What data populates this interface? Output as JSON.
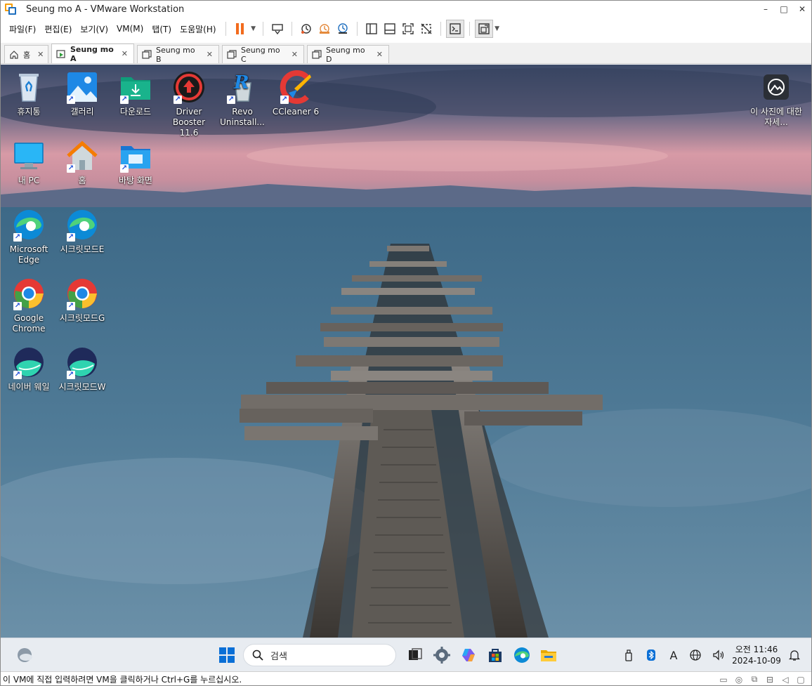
{
  "window": {
    "title": "Seung mo A - VMware Workstation",
    "minimize": "–",
    "maximize": "□",
    "close": "✕"
  },
  "menu": [
    "파일(F)",
    "편집(E)",
    "보기(V)",
    "VM(M)",
    "탭(T)",
    "도움말(H)"
  ],
  "tabs": [
    {
      "label": "홈",
      "icon": "home-icon",
      "active": false
    },
    {
      "label": "Seung mo A",
      "icon": "vm-running-icon",
      "active": true
    },
    {
      "label": "Seung mo B",
      "icon": "vm-icon",
      "active": false
    },
    {
      "label": "Seung mo C",
      "icon": "vm-icon",
      "active": false
    },
    {
      "label": "Seung mo D",
      "icon": "vm-icon",
      "active": false
    }
  ],
  "desktop": {
    "icons": [
      {
        "label": "휴지통",
        "icon": "recycle-bin-icon"
      },
      {
        "label": "갤러리",
        "icon": "gallery-icon"
      },
      {
        "label": "다운로드",
        "icon": "downloads-folder-icon"
      },
      {
        "label": "Driver Booster 11.6",
        "icon": "driver-booster-icon"
      },
      {
        "label": "Revo Uninstall...",
        "icon": "revo-uninstaller-icon"
      },
      {
        "label": "CCleaner 6",
        "icon": "ccleaner-icon"
      },
      {
        "label": "내 PC",
        "icon": "this-pc-icon"
      },
      {
        "label": "홈",
        "icon": "home-folder-icon"
      },
      {
        "label": "바탕 화면",
        "icon": "desktop-folder-icon"
      },
      {
        "label": "Microsoft Edge",
        "icon": "edge-icon"
      },
      {
        "label": "시크릿모드E",
        "icon": "edge-icon"
      },
      {
        "label": "Google Chrome",
        "icon": "chrome-icon"
      },
      {
        "label": "시크릿모드G",
        "icon": "chrome-icon"
      },
      {
        "label": "네이버 웨일",
        "icon": "whale-icon"
      },
      {
        "label": "시크릿모드W",
        "icon": "whale-icon"
      }
    ],
    "spotlight_label": "이 사진에 대한 자세...",
    "spotlight_icon": "spotlight-icon"
  },
  "taskbar": {
    "search_placeholder": "검색",
    "clock_time": "오전 11:46",
    "clock_date": "2024-10-09",
    "ime": "A"
  },
  "status": {
    "message": "이 VM에 직접 입력하려면 VM을 클릭하거나 Ctrl+G를 누르십시오."
  },
  "colors": {
    "accent": "#1f6fbf",
    "pause": "#f26b1d"
  }
}
